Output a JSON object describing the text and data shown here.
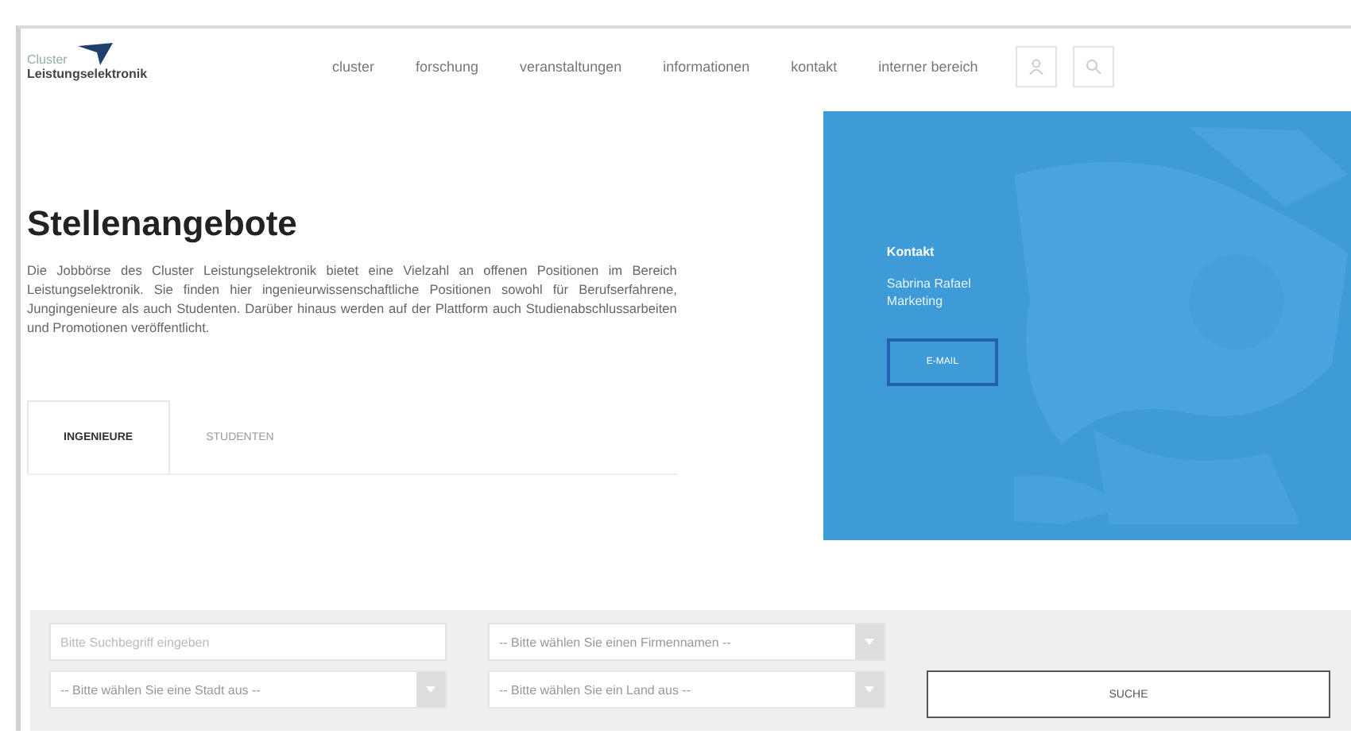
{
  "logo": {
    "line_1": "Cluster",
    "line_2": "Leistungselektronik"
  },
  "nav": {
    "items": [
      {
        "label": "cluster"
      },
      {
        "label": "forschung"
      },
      {
        "label": "veranstaltungen"
      },
      {
        "label": "informationen"
      },
      {
        "label": "kontakt"
      },
      {
        "label": "interner bereich"
      }
    ]
  },
  "intro": {
    "title": "Stellenangebote",
    "text": "Die Jobbörse des Cluster Leistungselektronik bietet eine Vielzahl an offenen Positionen im Bereich Leistungselektronik. Sie finden hier ingenieurwissenschaftliche Positionen sowohl für Berufserfahrene, Jungingenieure als auch Studenten. Darüber hinaus werden auf der Plattform auch Studienabschlussarbeiten und Promotionen veröffentlicht."
  },
  "contact_card": {
    "heading": "Kontakt",
    "name": "Sabrina Rafael",
    "role": "Marketing",
    "button": "E-MAIL"
  },
  "tabs": [
    {
      "label": "INGENIEURE",
      "selected": true
    },
    {
      "label": "STUDENTEN",
      "selected": false
    }
  ],
  "search": {
    "keyword": {
      "placeholder": "Bitte Suchbegriff eingeben"
    },
    "company": {
      "value": "-- Bitte wählen Sie einen Firmennamen --"
    },
    "city": {
      "value": "-- Bitte wählen Sie eine Stadt aus --"
    },
    "country": {
      "value": "-- Bitte wählen Sie ein Land aus --"
    },
    "button": "SUCHE"
  }
}
